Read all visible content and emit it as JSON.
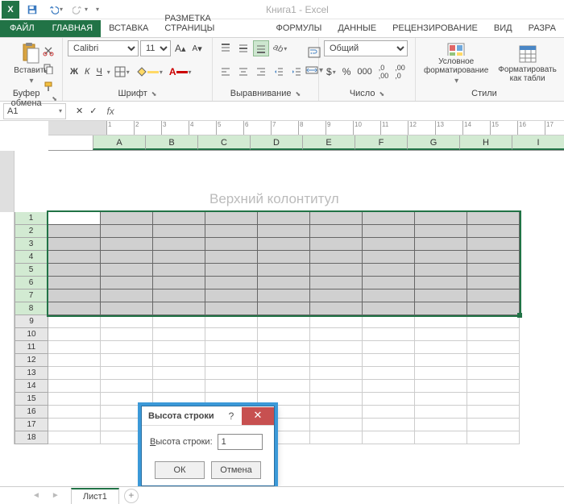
{
  "title": "Книга1 - Excel",
  "app_icon": "X",
  "tabs": {
    "file": "ФАЙЛ",
    "home": "ГЛАВНАЯ",
    "insert": "ВСТАВКА",
    "layout": "РАЗМЕТКА СТРАНИЦЫ",
    "formulas": "ФОРМУЛЫ",
    "data": "ДАННЫЕ",
    "review": "РЕЦЕНЗИРОВАНИЕ",
    "view": "ВИД",
    "dev": "РАЗРА"
  },
  "ribbon": {
    "clipboard": {
      "paste": "Вставить",
      "label": "Буфер обмена"
    },
    "font": {
      "name": "Calibri",
      "size": "11",
      "label": "Шрифт",
      "bold": "Ж",
      "italic": "К",
      "underline": "Ч"
    },
    "align": {
      "label": "Выравнивание"
    },
    "number": {
      "format": "Общий",
      "label": "Число"
    },
    "styles": {
      "cond": "Условное\nформатирование",
      "table": "Форматировать\nкак табли",
      "label": "Стили"
    }
  },
  "namebox": "A1",
  "columns": [
    "A",
    "B",
    "C",
    "D",
    "E",
    "F",
    "G",
    "H",
    "I"
  ],
  "rows": [
    1,
    2,
    3,
    4,
    5,
    6,
    7,
    8,
    9,
    10,
    11,
    12,
    13,
    14,
    15,
    16,
    17,
    18
  ],
  "headerText": "Верхний колонтитул",
  "dialog": {
    "title": "Высота строки",
    "label": "Высота строки:",
    "value": "1",
    "ok": "ОК",
    "cancel": "Отмена"
  },
  "sheet": {
    "tab": "Лист1"
  }
}
